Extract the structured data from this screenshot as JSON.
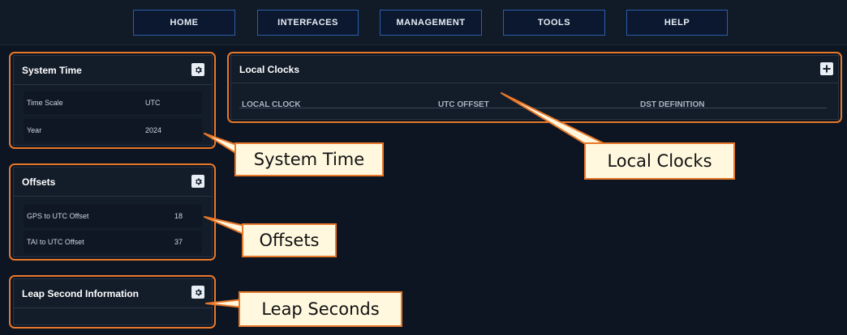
{
  "nav": {
    "home": "HOME",
    "interfaces": "INTERFACES",
    "management": "MANAGEMENT",
    "tools": "TOOLS",
    "help": "HELP"
  },
  "system_time": {
    "title": "System Time",
    "rows": [
      {
        "label": "Time Scale",
        "value": "UTC"
      },
      {
        "label": "Year",
        "value": "2024"
      }
    ]
  },
  "offsets": {
    "title": "Offsets",
    "rows": [
      {
        "label": "GPS to UTC Offset",
        "value": "18"
      },
      {
        "label": "TAI to UTC Offset",
        "value": "37"
      }
    ]
  },
  "leap_second": {
    "title": "Leap Second Information"
  },
  "local_clocks": {
    "title": "Local Clocks",
    "columns": [
      "LOCAL CLOCK",
      "UTC OFFSET",
      "DST DEFINITION"
    ]
  },
  "callouts": {
    "system_time": "System Time",
    "offsets": "Offsets",
    "leap_seconds": "Leap Seconds",
    "local_clocks": "Local Clocks"
  },
  "colors": {
    "accent_orange": "#e8782a",
    "nav_border": "#2d5ea8",
    "background": "#0d1522",
    "callout_bg": "#fff8df"
  }
}
